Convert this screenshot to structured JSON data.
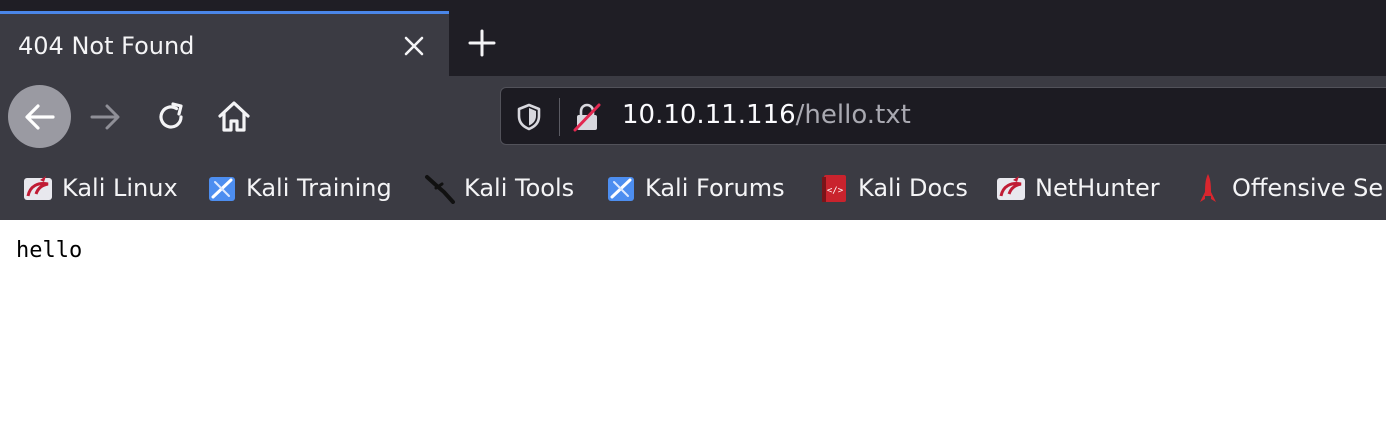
{
  "tab": {
    "title": "404 Not Found"
  },
  "urlbar": {
    "host": "10.10.11.116",
    "path": "/hello.txt"
  },
  "bookmarks": [
    {
      "label": "Kali Linux",
      "icon": "kali-dragon-icon"
    },
    {
      "label": "Kali Training",
      "icon": "kali-training-icon"
    },
    {
      "label": "Kali Tools",
      "icon": "kali-tools-icon"
    },
    {
      "label": "Kali Forums",
      "icon": "kali-forums-icon"
    },
    {
      "label": "Kali Docs",
      "icon": "kali-docs-icon"
    },
    {
      "label": "NetHunter",
      "icon": "nethunter-icon"
    },
    {
      "label": "Offensive Se",
      "icon": "offsec-icon"
    }
  ],
  "page": {
    "text": "hello"
  },
  "colors": {
    "accent": "#4a86e8",
    "toolbar": "#3b3b43",
    "tabstrip": "#1f1e25"
  }
}
